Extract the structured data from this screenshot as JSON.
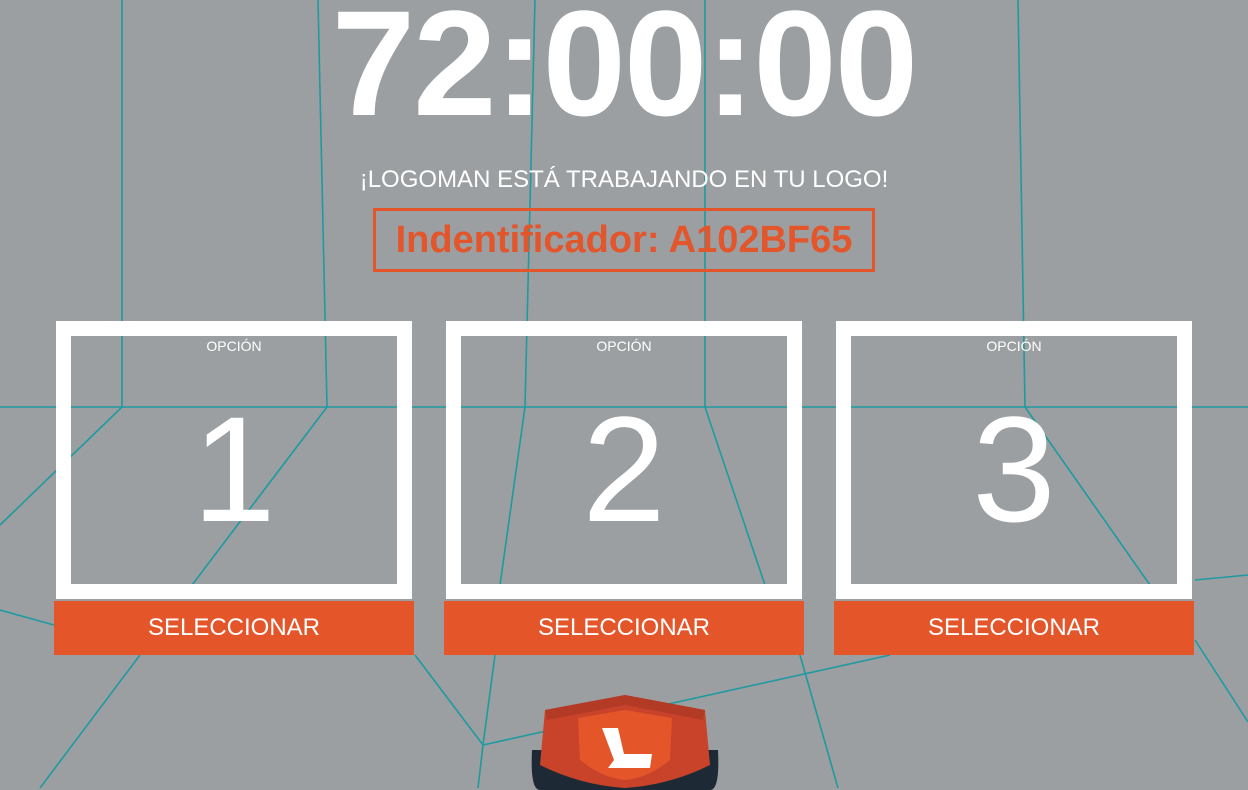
{
  "timer": "72:00:00",
  "subtitle": "¡LOGOMAN ESTÁ TRABAJANDO EN TU LOGO!",
  "identifier": "Indentificador: A102BF65",
  "options": [
    {
      "label": "OPCIÓN",
      "number": "1",
      "button": "SELECCIONAR"
    },
    {
      "label": "OPCIÓN",
      "number": "2",
      "button": "SELECCIONAR"
    },
    {
      "label": "OPCIÓN",
      "number": "3",
      "button": "SELECCIONAR"
    }
  ],
  "logo_icon": "logoman-shield-icon",
  "colors": {
    "background": "#9b9fa2",
    "accent": "#e4552a",
    "lines": "#1f9aa0",
    "text": "#ffffff"
  }
}
